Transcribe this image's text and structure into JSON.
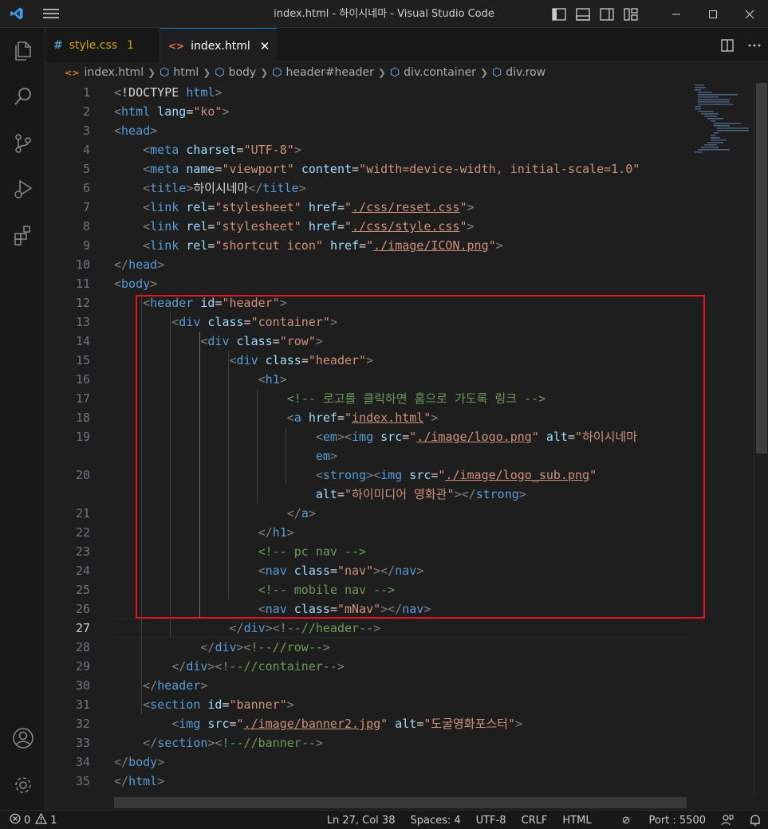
{
  "window": {
    "title": "index.html - 하이시네마 - Visual Studio Code"
  },
  "tabs": [
    {
      "icon": "#",
      "label": "style.css",
      "badge": "1",
      "active": false
    },
    {
      "icon": "<>",
      "label": "index.html",
      "close": "✕",
      "active": true
    }
  ],
  "breadcrumb": [
    "index.html",
    "html",
    "body",
    "header#header",
    "div.container",
    "div.row"
  ],
  "editor": {
    "active_line": 27,
    "lines": [
      [
        [
          "t",
          "<"
        ],
        [
          "tx",
          "!DOCTYPE "
        ],
        [
          "tn",
          "html"
        ],
        [
          "t",
          ">"
        ]
      ],
      [
        [
          "t",
          "<"
        ],
        [
          "tn",
          "html"
        ],
        [
          "tx",
          " "
        ],
        [
          "an",
          "lang"
        ],
        [
          "tx",
          "="
        ],
        [
          "av",
          "\"ko\""
        ],
        [
          "t",
          ">"
        ]
      ],
      [
        [
          "t",
          "<"
        ],
        [
          "tn",
          "head"
        ],
        [
          "t",
          ">"
        ]
      ],
      [
        [
          "tx",
          "    "
        ],
        [
          "t",
          "<"
        ],
        [
          "tn",
          "meta"
        ],
        [
          "tx",
          " "
        ],
        [
          "an",
          "charset"
        ],
        [
          "tx",
          "="
        ],
        [
          "av",
          "\"UTF-8\""
        ],
        [
          "t",
          ">"
        ]
      ],
      [
        [
          "tx",
          "    "
        ],
        [
          "t",
          "<"
        ],
        [
          "tn",
          "meta"
        ],
        [
          "tx",
          " "
        ],
        [
          "an",
          "name"
        ],
        [
          "tx",
          "="
        ],
        [
          "av",
          "\"viewport\""
        ],
        [
          "tx",
          " "
        ],
        [
          "an",
          "content"
        ],
        [
          "tx",
          "="
        ],
        [
          "av",
          "\"width=device-width, initial-scale=1.0\""
        ]
      ],
      [
        [
          "tx",
          "    "
        ],
        [
          "t",
          "<"
        ],
        [
          "tn",
          "title"
        ],
        [
          "t",
          ">"
        ],
        [
          "tx",
          "하이시네마"
        ],
        [
          "t",
          "</"
        ],
        [
          "tn",
          "title"
        ],
        [
          "t",
          ">"
        ]
      ],
      [
        [
          "tx",
          "    "
        ],
        [
          "t",
          "<"
        ],
        [
          "tn",
          "link"
        ],
        [
          "tx",
          " "
        ],
        [
          "an",
          "rel"
        ],
        [
          "tx",
          "="
        ],
        [
          "av",
          "\"stylesheet\""
        ],
        [
          "tx",
          " "
        ],
        [
          "an",
          "href"
        ],
        [
          "tx",
          "="
        ],
        [
          "av",
          "\""
        ],
        [
          "avu",
          "./css/reset.css"
        ],
        [
          "av",
          "\""
        ],
        [
          "t",
          ">"
        ]
      ],
      [
        [
          "tx",
          "    "
        ],
        [
          "t",
          "<"
        ],
        [
          "tn",
          "link"
        ],
        [
          "tx",
          " "
        ],
        [
          "an",
          "rel"
        ],
        [
          "tx",
          "="
        ],
        [
          "av",
          "\"stylesheet\""
        ],
        [
          "tx",
          " "
        ],
        [
          "an",
          "href"
        ],
        [
          "tx",
          "="
        ],
        [
          "av",
          "\""
        ],
        [
          "avu",
          "./css/style.css"
        ],
        [
          "av",
          "\""
        ],
        [
          "t",
          ">"
        ]
      ],
      [
        [
          "tx",
          "    "
        ],
        [
          "t",
          "<"
        ],
        [
          "tn",
          "link"
        ],
        [
          "tx",
          " "
        ],
        [
          "an",
          "rel"
        ],
        [
          "tx",
          "="
        ],
        [
          "av",
          "\"shortcut icon\""
        ],
        [
          "tx",
          " "
        ],
        [
          "an",
          "href"
        ],
        [
          "tx",
          "="
        ],
        [
          "av",
          "\""
        ],
        [
          "avu",
          "./image/ICON.png"
        ],
        [
          "av",
          "\""
        ],
        [
          "t",
          ">"
        ]
      ],
      [
        [
          "t",
          "</"
        ],
        [
          "tn",
          "head"
        ],
        [
          "t",
          ">"
        ]
      ],
      [
        [
          "t",
          "<"
        ],
        [
          "tn",
          "body"
        ],
        [
          "t",
          ">"
        ]
      ],
      [
        [
          "tx",
          "    "
        ],
        [
          "t",
          "<"
        ],
        [
          "tn",
          "header"
        ],
        [
          "tx",
          " "
        ],
        [
          "an",
          "id"
        ],
        [
          "tx",
          "="
        ],
        [
          "av",
          "\"header\""
        ],
        [
          "t",
          ">"
        ]
      ],
      [
        [
          "tx",
          "        "
        ],
        [
          "t",
          "<"
        ],
        [
          "tn",
          "div"
        ],
        [
          "tx",
          " "
        ],
        [
          "an",
          "class"
        ],
        [
          "tx",
          "="
        ],
        [
          "av",
          "\"container\""
        ],
        [
          "t",
          ">"
        ]
      ],
      [
        [
          "tx",
          "            "
        ],
        [
          "t",
          "<"
        ],
        [
          "tn",
          "div"
        ],
        [
          "tx",
          " "
        ],
        [
          "an",
          "class"
        ],
        [
          "tx",
          "="
        ],
        [
          "av",
          "\"row\""
        ],
        [
          "t",
          ">"
        ]
      ],
      [
        [
          "tx",
          "                "
        ],
        [
          "t",
          "<"
        ],
        [
          "tn",
          "div"
        ],
        [
          "tx",
          " "
        ],
        [
          "an",
          "class"
        ],
        [
          "tx",
          "="
        ],
        [
          "av",
          "\"header\""
        ],
        [
          "t",
          ">"
        ]
      ],
      [
        [
          "tx",
          "                    "
        ],
        [
          "t",
          "<"
        ],
        [
          "tn",
          "h1"
        ],
        [
          "t",
          ">"
        ]
      ],
      [
        [
          "tx",
          "                        "
        ],
        [
          "cm",
          "<!-- 로고를 클릭하면 홈으로 가도록 링크 -->"
        ]
      ],
      [
        [
          "tx",
          "                        "
        ],
        [
          "t",
          "<"
        ],
        [
          "tn",
          "a"
        ],
        [
          "tx",
          " "
        ],
        [
          "an",
          "href"
        ],
        [
          "tx",
          "="
        ],
        [
          "av",
          "\""
        ],
        [
          "avu",
          "index.html"
        ],
        [
          "av",
          "\""
        ],
        [
          "t",
          ">"
        ]
      ],
      [
        [
          "tx",
          "                            "
        ],
        [
          "t",
          "<"
        ],
        [
          "tn",
          "em"
        ],
        [
          "t",
          "><"
        ],
        [
          "tn",
          "img"
        ],
        [
          "tx",
          " "
        ],
        [
          "an",
          "src"
        ],
        [
          "tx",
          "="
        ],
        [
          "av",
          "\""
        ],
        [
          "avu",
          "./image/logo.png"
        ],
        [
          "av",
          "\""
        ],
        [
          "tx",
          " "
        ],
        [
          "an",
          "alt"
        ],
        [
          "tx",
          "="
        ],
        [
          "av",
          "\"하이시네마"
        ]
      ],
      [
        [
          "tx",
          "                            "
        ],
        [
          "tn",
          "em"
        ],
        [
          "t",
          ">"
        ]
      ],
      [
        [
          "tx",
          "                            "
        ],
        [
          "t",
          "<"
        ],
        [
          "tn",
          "strong"
        ],
        [
          "t",
          "><"
        ],
        [
          "tn",
          "img"
        ],
        [
          "tx",
          " "
        ],
        [
          "an",
          "src"
        ],
        [
          "tx",
          "="
        ],
        [
          "av",
          "\""
        ],
        [
          "avu",
          "./image/logo_sub.png"
        ],
        [
          "av",
          "\""
        ]
      ],
      [
        [
          "tx",
          "                            "
        ],
        [
          "an",
          "alt"
        ],
        [
          "tx",
          "="
        ],
        [
          "av",
          "\"하이미디어 영화관\""
        ],
        [
          "t",
          "></"
        ],
        [
          "tn",
          "strong"
        ],
        [
          "t",
          ">"
        ]
      ],
      [
        [
          "tx",
          "                        "
        ],
        [
          "t",
          "</"
        ],
        [
          "tn",
          "a"
        ],
        [
          "t",
          ">"
        ]
      ],
      [
        [
          "tx",
          "                    "
        ],
        [
          "t",
          "</"
        ],
        [
          "tn",
          "h1"
        ],
        [
          "t",
          ">"
        ]
      ],
      [
        [
          "tx",
          "                    "
        ],
        [
          "cm",
          "<!-- pc nav -->"
        ]
      ],
      [
        [
          "tx",
          "                    "
        ],
        [
          "t",
          "<"
        ],
        [
          "tn",
          "nav"
        ],
        [
          "tx",
          " "
        ],
        [
          "an",
          "class"
        ],
        [
          "tx",
          "="
        ],
        [
          "av",
          "\"nav\""
        ],
        [
          "t",
          "></"
        ],
        [
          "tn",
          "nav"
        ],
        [
          "t",
          ">"
        ]
      ],
      [
        [
          "tx",
          "                    "
        ],
        [
          "cm",
          "<!-- mobile nav -->"
        ]
      ],
      [
        [
          "tx",
          "                    "
        ],
        [
          "t",
          "<"
        ],
        [
          "tn",
          "nav"
        ],
        [
          "tx",
          " "
        ],
        [
          "an",
          "class"
        ],
        [
          "tx",
          "="
        ],
        [
          "av",
          "\"mNav\""
        ],
        [
          "t",
          "></"
        ],
        [
          "tn",
          "nav"
        ],
        [
          "t",
          ">"
        ]
      ],
      [
        [
          "tx",
          "                "
        ],
        [
          "t",
          "</"
        ],
        [
          "tn",
          "div"
        ],
        [
          "t",
          "><"
        ],
        [
          "cm",
          "!--//header--"
        ],
        [
          "t",
          ">"
        ]
      ],
      [
        [
          "tx",
          "            "
        ],
        [
          "t",
          "</"
        ],
        [
          "tn",
          "div"
        ],
        [
          "t",
          "><"
        ],
        [
          "cm",
          "!--//row--"
        ],
        [
          "t",
          ">"
        ]
      ],
      [
        [
          "tx",
          "        "
        ],
        [
          "t",
          "</"
        ],
        [
          "tn",
          "div"
        ],
        [
          "t",
          "><"
        ],
        [
          "cm",
          "!--//container--"
        ],
        [
          "t",
          ">"
        ]
      ],
      [
        [
          "tx",
          "    "
        ],
        [
          "t",
          "</"
        ],
        [
          "tn",
          "header"
        ],
        [
          "t",
          ">"
        ]
      ],
      [
        [
          "tx",
          "    "
        ],
        [
          "t",
          "<"
        ],
        [
          "tn",
          "section"
        ],
        [
          "tx",
          " "
        ],
        [
          "an",
          "id"
        ],
        [
          "tx",
          "="
        ],
        [
          "av",
          "\"banner\""
        ],
        [
          "t",
          ">"
        ]
      ],
      [
        [
          "tx",
          "        "
        ],
        [
          "t",
          "<"
        ],
        [
          "tn",
          "img"
        ],
        [
          "tx",
          " "
        ],
        [
          "an",
          "src"
        ],
        [
          "tx",
          "="
        ],
        [
          "av",
          "\""
        ],
        [
          "avu",
          "./image/banner2.jpg"
        ],
        [
          "av",
          "\""
        ],
        [
          "tx",
          " "
        ],
        [
          "an",
          "alt"
        ],
        [
          "tx",
          "="
        ],
        [
          "av",
          "\"도굴영화포스터\""
        ],
        [
          "t",
          ">"
        ]
      ],
      [
        [
          "tx",
          "    "
        ],
        [
          "t",
          "</"
        ],
        [
          "tn",
          "section"
        ],
        [
          "t",
          "><"
        ],
        [
          "cm",
          "!--//banner--"
        ],
        [
          "t",
          ">"
        ]
      ],
      [
        [
          "t",
          "</"
        ],
        [
          "tn",
          "body"
        ],
        [
          "t",
          ">"
        ]
      ],
      [
        [
          "t",
          "</"
        ],
        [
          "tn",
          "html"
        ],
        [
          "t",
          ">"
        ]
      ]
    ],
    "line_numbers": [
      "1",
      "2",
      "3",
      "4",
      "5",
      "6",
      "7",
      "8",
      "9",
      "10",
      "11",
      "12",
      "13",
      "14",
      "15",
      "16",
      "17",
      "18",
      "19",
      "",
      "20",
      "",
      "21",
      "22",
      "23",
      "24",
      "25",
      "26",
      "27",
      "28",
      "29",
      "30",
      "31",
      "32",
      "33",
      "34",
      "35"
    ]
  },
  "statusbar": {
    "errors": "0",
    "warnings": "1",
    "position": "Ln 27, Col 38",
    "spaces": "Spaces: 4",
    "encoding": "UTF-8",
    "eol": "CRLF",
    "language": "HTML",
    "port": "Port : 5500"
  },
  "colors": {
    "accent": "#0078d4",
    "highlight_box": "#e81123"
  }
}
